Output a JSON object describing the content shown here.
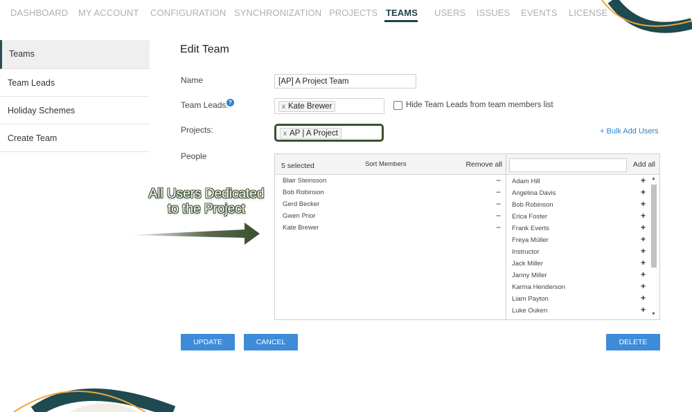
{
  "nav": {
    "tabs": [
      "DASHBOARD",
      "MY ACCOUNT",
      "CONFIGURATION",
      "SYNCHRONIZATION",
      "PROJECTS",
      "TEAMS",
      "USERS",
      "ISSUES",
      "EVENTS",
      "LICENSE"
    ],
    "active": "TEAMS"
  },
  "sidebar": {
    "items": [
      {
        "label": "Teams"
      },
      {
        "label": "Team Leads"
      },
      {
        "label": "Holiday Schemes"
      },
      {
        "label": "Create Team"
      }
    ]
  },
  "form": {
    "title": "Edit Team",
    "name_label": "Name",
    "name_value": "[AP] A Project Team",
    "team_leads_label": "Team Leads:",
    "team_lead_chip": "Kate Brewer",
    "hide_leads_label": "Hide Team Leads from team members list",
    "projects_label": "Projects:",
    "project_chip": "AP | A Project",
    "bulk_add_link": "+ Bulk Add Users",
    "people_label": "People"
  },
  "people": {
    "selected_count": "5 selected",
    "sort_members": "Sort Members",
    "remove_all": "Remove all",
    "add_all": "Add all",
    "members": [
      "Blair Steinsson",
      "Bob Robinson",
      "Gerd Becker",
      "Gwen Prior",
      "Kate Brewer"
    ],
    "users": [
      "Adam Hill",
      "Angelina Davis",
      "Bob Robinson",
      "Erica Foster",
      "Frank Everts",
      "Freya Müller",
      "Instructor",
      "Jack Miller",
      "Janny Miller",
      "Karma Henderson",
      "Liam Payton",
      "Luke Ouken"
    ]
  },
  "buttons": {
    "update": "UPDATE",
    "cancel": "CANCEL",
    "delete": "DELETE"
  },
  "annotation": {
    "line1": "All Users Dedicated",
    "line2": "to the Project"
  },
  "colors": {
    "accent_blue": "#3d8bd9",
    "brand_dark": "#1f3f4a",
    "deco_orange": "#f0a43a",
    "highlight_green": "#3b4f2f"
  }
}
